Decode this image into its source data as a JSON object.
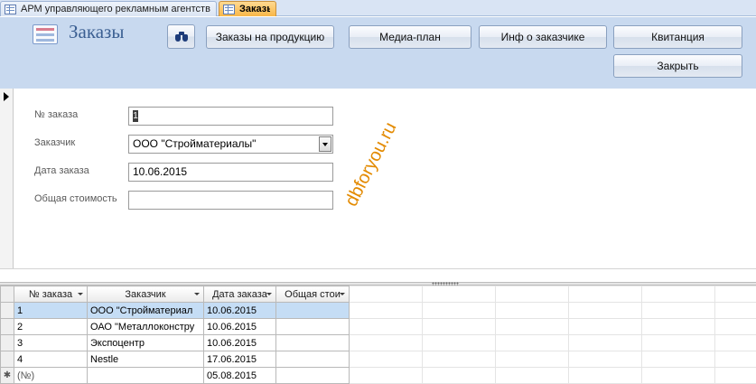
{
  "tabs": [
    {
      "label": "АРМ управляющего рекламным агентством",
      "active": false
    },
    {
      "label": "Заказы",
      "active": true
    }
  ],
  "header": {
    "title": "Заказы",
    "buttons": {
      "search_icon": "binoculars-icon",
      "products": "Заказы на продукцию",
      "media_plan": "Медиа-план",
      "customer_info": "Инф о заказчике",
      "receipt": "Квитанция",
      "close": "Закрыть"
    }
  },
  "form": {
    "order_no": {
      "label": "№ заказа",
      "value": "1"
    },
    "customer": {
      "label": "Заказчик",
      "value": "ООО \"Стройматериалы\""
    },
    "order_date": {
      "label": "Дата заказа",
      "value": "10.06.2015"
    },
    "total": {
      "label": "Общая стоимость",
      "value": ""
    }
  },
  "watermark": "dbforyou.ru",
  "datasheet": {
    "columns": [
      "№ заказа",
      "Заказчик",
      "Дата заказа",
      "Общая стои"
    ],
    "rows": [
      {
        "order_no": "1",
        "customer": "ООО \"Стройматериал",
        "date": "10.06.2015",
        "total": ""
      },
      {
        "order_no": "2",
        "customer": "ОАО \"Металлоконстру",
        "date": "10.06.2015",
        "total": ""
      },
      {
        "order_no": "3",
        "customer": "Экспоцентр",
        "date": "10.06.2015",
        "total": ""
      },
      {
        "order_no": "4",
        "customer": "Nestle",
        "date": "17.06.2015",
        "total": ""
      }
    ],
    "new_row": {
      "marker": "✱",
      "order_no": "(№)",
      "customer": "",
      "date": "05.08.2015",
      "total": ""
    }
  }
}
